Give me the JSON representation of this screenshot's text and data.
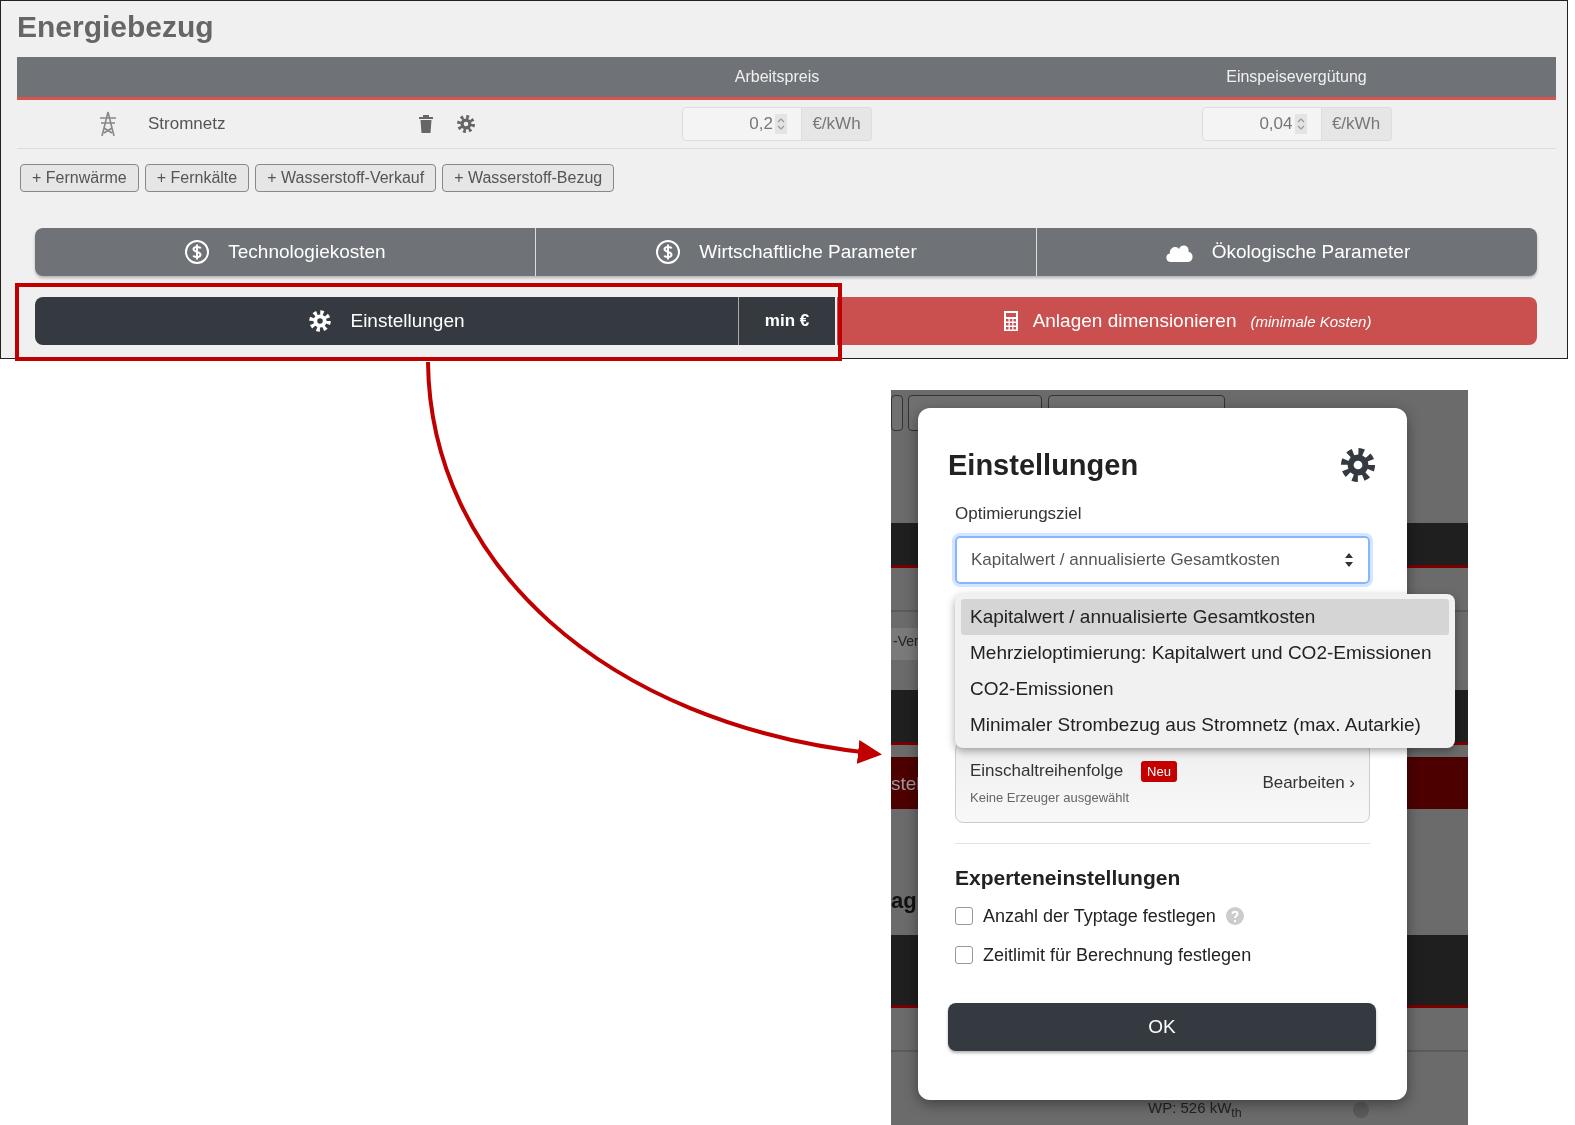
{
  "panel": {
    "title": "Energiebezug",
    "columns": [
      {
        "label": "Arbeitspreis"
      },
      {
        "label": "Einspeisevergütung"
      }
    ],
    "rows": [
      {
        "name": "Stromnetz",
        "prices": [
          {
            "value": "0,2",
            "unit": "€/kWh"
          },
          {
            "value": "0,04",
            "unit": "€/kWh"
          }
        ]
      }
    ],
    "add_buttons": [
      "+ Fernwärme",
      "+ Fernkälte",
      "+ Wasserstoff-Verkauf",
      "+ Wasserstoff-Bezug"
    ],
    "tabs": [
      {
        "label": "Technologiekosten"
      },
      {
        "label": "Wirtschaftliche Parameter"
      },
      {
        "label": "Ökologische Parameter"
      }
    ],
    "settings_button": {
      "label": "Einstellungen",
      "mode": "min €"
    },
    "run_button": {
      "label": "Anlagen dimensionieren",
      "note": "(minimale Kosten)"
    }
  },
  "dialog_background": {
    "fragments": [
      "-Ver",
      "stel",
      "ag",
      "WP: 526 kW$_{th}$"
    ]
  },
  "dialog": {
    "title": "Einstellungen",
    "field_label": "Optimierungsziel",
    "select": {
      "value": "Kapitalwert / annualisierte Gesamtkosten",
      "options": [
        {
          "label": "Kapitalwert / annualisierte Gesamtkosten",
          "selected": true
        },
        {
          "label": "Mehrzieloptimierung: Kapitalwert und CO2-Emissionen",
          "selected": false
        },
        {
          "label": "CO2-Emissionen",
          "selected": false
        },
        {
          "label": "Minimaler Strombezug aus Stromnetz (max. Autarkie)",
          "selected": false
        }
      ]
    },
    "sequence_card": {
      "title": "Einschaltreihenfolge",
      "badge": "Neu",
      "subtitle": "Keine Erzeuger ausgewählt",
      "action": "Bearbeiten ›"
    },
    "expert_title": "Experteneinstellungen",
    "checkboxes": [
      {
        "label": "Anzahl der Typtage festlegen",
        "checked": false,
        "help": true
      },
      {
        "label": "Zeitlimit für Berechnung festlegen",
        "checked": false,
        "help": false
      }
    ],
    "ok": "OK"
  }
}
